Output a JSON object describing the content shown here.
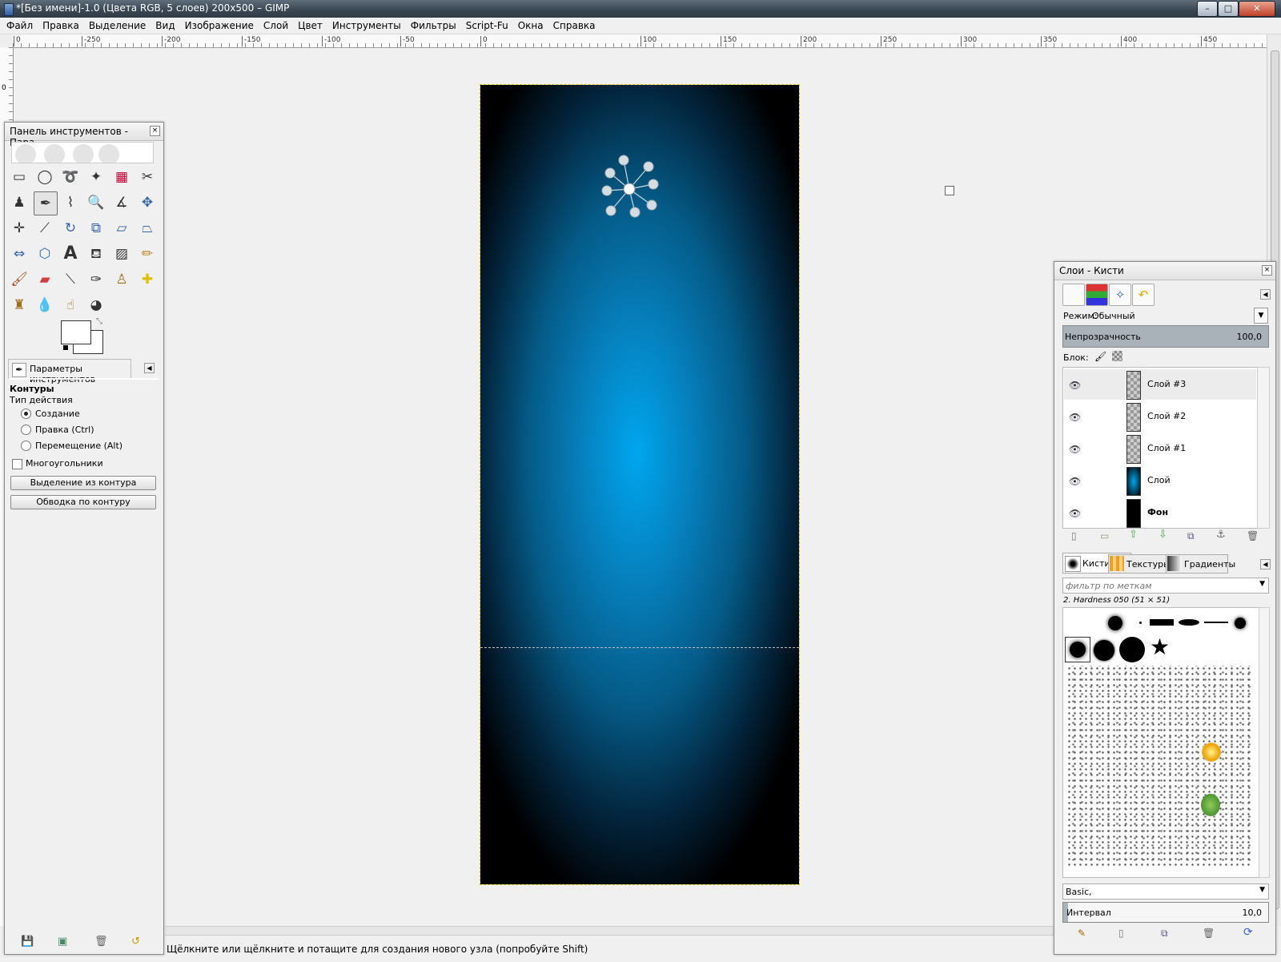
{
  "window": {
    "title": "*[Без имени]-1.0 (Цвета RGB, 5 слоев) 200x500 – GIMP",
    "controls": {
      "minimize": "–",
      "maximize": "□",
      "close": "✕"
    }
  },
  "menu": [
    "Файл",
    "Правка",
    "Выделение",
    "Вид",
    "Изображение",
    "Слой",
    "Цвет",
    "Инструменты",
    "Фильтры",
    "Script-Fu",
    "Окна",
    "Справка"
  ],
  "ruler": {
    "h_ticks": [
      "0",
      "-250",
      "-200",
      "-150",
      "-100",
      "-50",
      "0",
      "100",
      "150",
      "200",
      "250",
      "300",
      "350",
      "400",
      "450"
    ],
    "v_ticks": [
      "0"
    ]
  },
  "toolbox": {
    "title": "Панель инструментов - Пара...",
    "tab_label": "Параметры инструментов",
    "section_title": "Контуры",
    "action_type_label": "Тип действия",
    "options": [
      "Создание",
      "Правка (Ctrl)",
      "Перемещение (Alt)"
    ],
    "selected_option": 0,
    "polygon_label": "Многоугольники",
    "polygon_checked": false,
    "btn_selection_from_path": "Выделение из контура",
    "btn_stroke_path": "Обводка по контуру"
  },
  "status_text": "Щёлкните или щёлкните и потащите для создания нового узла (попробуйте Shift)",
  "layers_dock": {
    "title": "Слои - Кисти",
    "mode_label": "Режим:",
    "mode_value": "Обычный",
    "opacity_label": "Непрозрачность",
    "opacity_value": "100,0",
    "lock_label": "Блок:",
    "layers": [
      {
        "name": "Слой #3",
        "bold": false,
        "thumb": "transparent"
      },
      {
        "name": "Слой #2",
        "bold": false,
        "thumb": "transparent"
      },
      {
        "name": "Слой #1",
        "bold": false,
        "thumb": "transparent"
      },
      {
        "name": "Слой",
        "bold": false,
        "thumb": "blue"
      },
      {
        "name": "Фон",
        "bold": true,
        "thumb": "black"
      }
    ],
    "tabs": {
      "brushes": "Кисти",
      "patterns": "Текстуры",
      "gradients": "Градиенты"
    },
    "filter_placeholder": "фильтр по меткам",
    "brush_name": "2. Hardness 050 (51 × 51)",
    "preset": "Basic,",
    "spacing_label": "Интервал",
    "spacing_value": "10,0"
  },
  "colors": {
    "fg": "#ffffff",
    "bg": "#ffffff",
    "canvas_center": "#00a6ee"
  }
}
